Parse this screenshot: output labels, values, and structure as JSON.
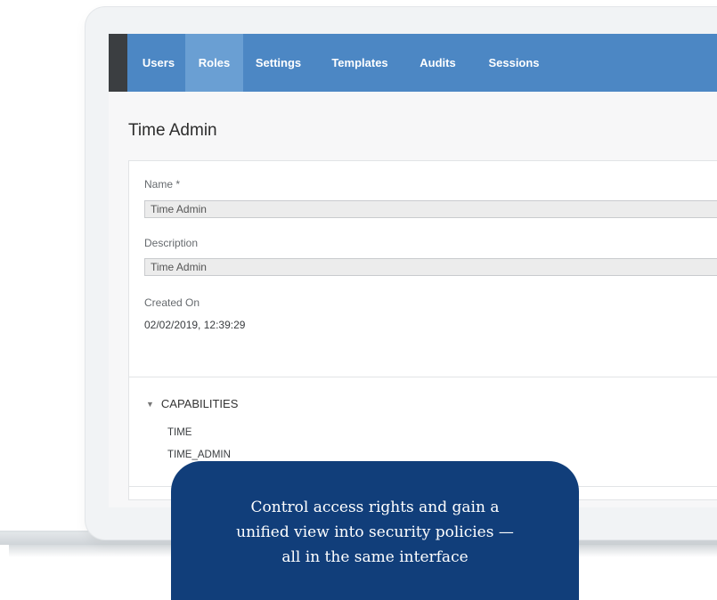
{
  "nav": {
    "tabs": [
      {
        "label": "Users",
        "active": false
      },
      {
        "label": "Roles",
        "active": true
      },
      {
        "label": "Settings",
        "active": false
      },
      {
        "label": "Templates",
        "active": false
      },
      {
        "label": "Audits",
        "active": false
      },
      {
        "label": "Sessions",
        "active": false
      }
    ]
  },
  "page": {
    "title": "Time Admin"
  },
  "form": {
    "name_label": "Name *",
    "name_value": "Time Admin",
    "description_label": "Description",
    "description_value": "Time Admin",
    "created_label": "Created On",
    "created_value": "02/02/2019, 12:39:29"
  },
  "capabilities": {
    "header": "CAPABILITIES",
    "expanded": true,
    "items": [
      "TIME",
      "TIME_ADMIN"
    ]
  },
  "callout": {
    "line1": "Control access rights and gain a",
    "line2": "unified view into security policies —",
    "line3": "all in the same interface"
  },
  "colors": {
    "nav_bg": "#4c87c4",
    "nav_active": "#6a9fd3",
    "callout_bg": "#113e7a"
  }
}
